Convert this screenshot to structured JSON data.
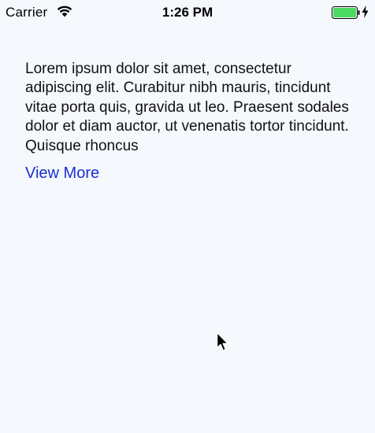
{
  "status_bar": {
    "carrier": "Carrier",
    "time": "1:26 PM",
    "wifi_icon": "wifi-icon",
    "battery_icon": "battery-icon",
    "charging_icon": "charging-bolt-icon",
    "battery_color": "#4cd964"
  },
  "main": {
    "body_text": "Lorem ipsum dolor sit amet, consectetur adipiscing elit. Curabitur nibh mauris, tincidunt vitae porta quis, gravida ut leo. Praesent sodales dolor et diam auctor, ut venenatis tortor tincidunt. Quisque rhoncus",
    "view_more_label": "View More",
    "link_color": "#1a2fd1"
  },
  "cursor_icon": "mouse-pointer-icon"
}
